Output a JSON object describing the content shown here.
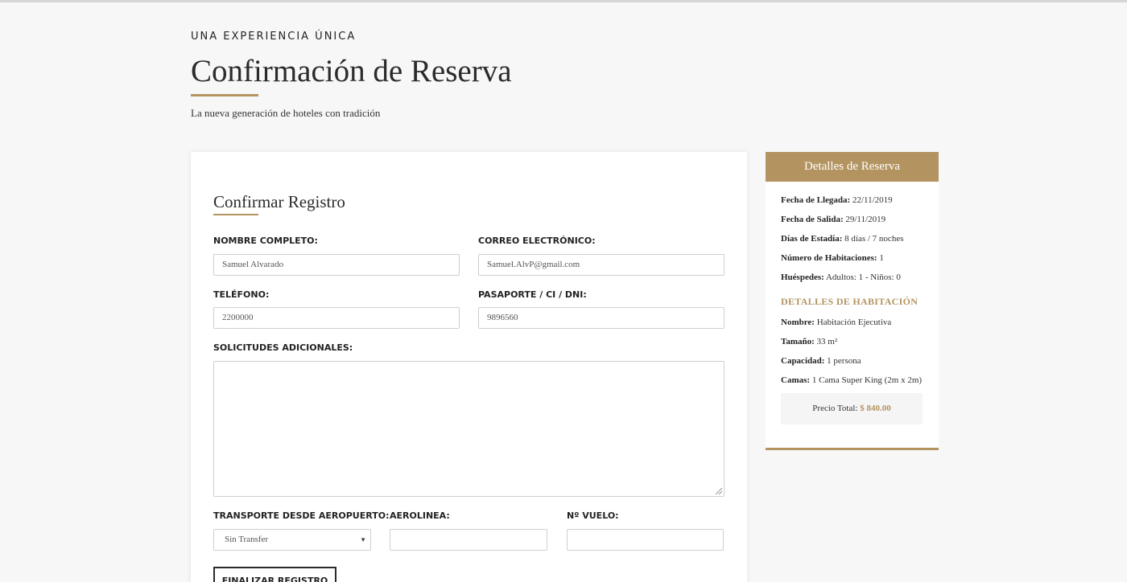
{
  "header": {
    "eyebrow": "UNA EXPERIENCIA ÚNICA",
    "title": "Confirmación de Reserva",
    "subtitle": "La nueva generación de hoteles con tradición"
  },
  "form": {
    "section_title": "Confirmar Registro",
    "fields": {
      "full_name": {
        "label": "NOMBRE COMPLETO:",
        "value": "Samuel Alvarado"
      },
      "email": {
        "label": "CORREO ELECTRÓNICO:",
        "value": "Samuel.AlvP@gmail.com"
      },
      "phone": {
        "label": "TELÉFONO:",
        "value": "2200000"
      },
      "passport": {
        "label": "PASAPORTE / CI / DNI:",
        "value": "9896560"
      },
      "requests": {
        "label": "SOLICITUDES ADICIONALES:",
        "value": ""
      },
      "transport": {
        "label": "TRANSPORTE DESDE AEROPUERTO:",
        "value": "Sin Transfer"
      },
      "airline": {
        "label": "AEROLINEA:",
        "value": ""
      },
      "flight": {
        "label": "Nº VUELO:",
        "value": ""
      }
    },
    "submit_label": "FINALIZAR REGISTRO"
  },
  "details": {
    "header": "Detalles de Reserva",
    "rows": [
      {
        "label": "Fecha de Llegada:",
        "value": "22/11/2019"
      },
      {
        "label": "Fecha de Salida:",
        "value": "29/11/2019"
      },
      {
        "label": "Días de Estadía:",
        "value": "8 días / 7 noches"
      },
      {
        "label": "Número de Habitaciones:",
        "value": "1"
      },
      {
        "label": "Huéspedes:",
        "value": "Adultos: 1 - Niños: 0"
      }
    ],
    "room_heading": "DETALLES DE HABITACIÓN",
    "room_rows": [
      {
        "label": "Nombre:",
        "value": "Habitación Ejecutiva"
      },
      {
        "label": "Tamaño:",
        "value": "33 m²"
      },
      {
        "label": "Capacidad:",
        "value": "1 persona"
      },
      {
        "label": "Camas:",
        "value": "1 Cama Super King (2m x 2m)"
      }
    ],
    "price_label": "Precio Total:",
    "price_value": "$ 840.00"
  },
  "colors": {
    "accent": "#b39461",
    "background": "#f7f7f7"
  }
}
